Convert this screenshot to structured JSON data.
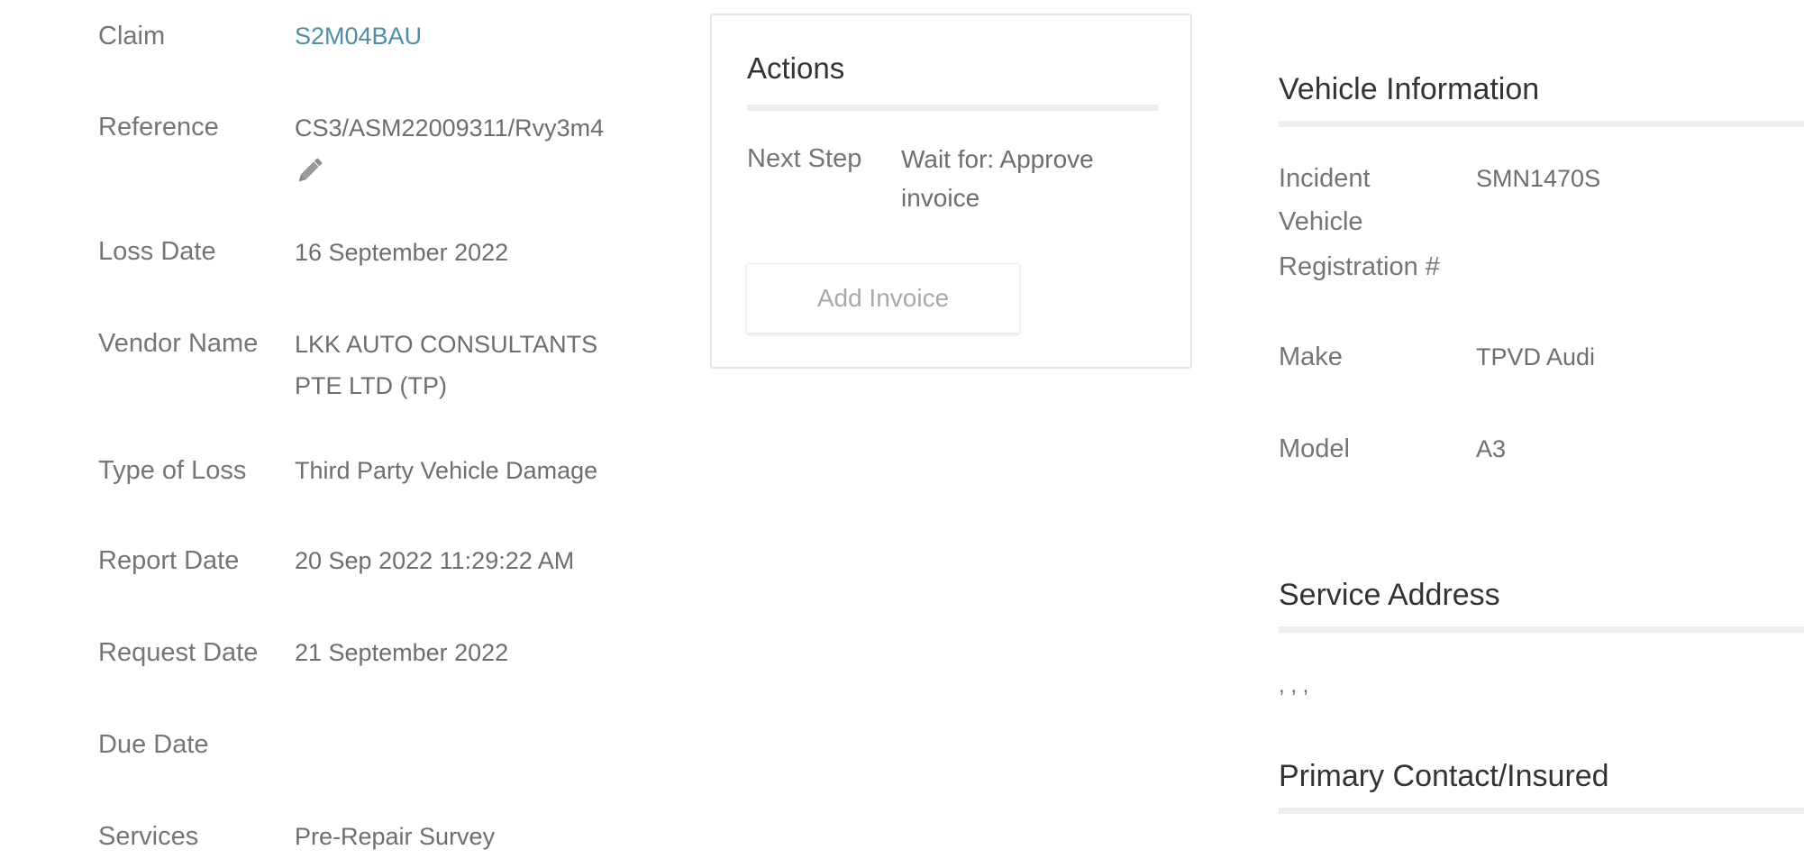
{
  "claim_details": {
    "rows": [
      {
        "label": "Claim",
        "value": "S2M04BAU"
      },
      {
        "label": "Reference",
        "value": "CS3/ASM22009311/Rvy3m4"
      },
      {
        "label": "Loss Date",
        "value": "16 September 2022"
      },
      {
        "label": "Vendor Name",
        "value_line1": "LKK AUTO CONSULTANTS",
        "value_line2": "PTE LTD (TP)"
      },
      {
        "label": "Type of Loss",
        "value": "Third Party Vehicle Damage"
      },
      {
        "label": "Report Date",
        "value": "20 Sep 2022 11:29:22 AM"
      },
      {
        "label": "Request Date",
        "value": "21 September 2022"
      },
      {
        "label": "Due Date",
        "value": ""
      },
      {
        "label": "Services",
        "value": "Pre-Repair Survey"
      }
    ]
  },
  "actions": {
    "title": "Actions",
    "next_step_label": "Next Step",
    "next_step_value_line1": "Wait for: Approve",
    "next_step_value_line2": "invoice",
    "add_invoice_label": "Add Invoice"
  },
  "vehicle_information": {
    "title": "Vehicle Information",
    "registration_label_line1": "Incident",
    "registration_label_line2": "Vehicle",
    "registration_label_line3": "Registration #",
    "registration_value": "SMN1470S",
    "make_label": "Make",
    "make_value": "TPVD Audi",
    "model_label": "Model",
    "model_value": "A3"
  },
  "service_address": {
    "title": "Service Address",
    "value": ", , ,"
  },
  "primary_contact": {
    "title": "Primary Contact/Insured"
  },
  "colors": {
    "link": "#4f8ea6",
    "heading": "#333333",
    "text": "#6e6e6e",
    "rule": "#eeeeee"
  }
}
